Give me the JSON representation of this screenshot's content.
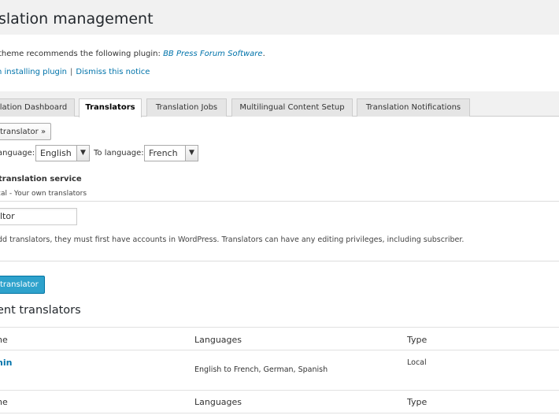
{
  "header": {
    "title": "slation management"
  },
  "notice": {
    "text": "theme recommends the following plugin:",
    "plugin_name": "BB Press Forum Software",
    "after_plugin": ".",
    "action_install": "n installing plugin",
    "separator": "|",
    "action_dismiss": "Dismiss this notice"
  },
  "tabs": [
    {
      "label": "lation Dashboard",
      "active": false
    },
    {
      "label": "Translators",
      "active": true
    },
    {
      "label": "Translation Jobs",
      "active": false
    },
    {
      "label": "Multilingual Content Setup",
      "active": false
    },
    {
      "label": "Translation Notifications",
      "active": false
    }
  ],
  "form": {
    "add_translator_button": "translator »",
    "from_language_label": "anguage:",
    "from_language_value": "English",
    "to_language_label": "To language:",
    "to_language_value": "French",
    "service_title": "translation service",
    "service_desc": "cal - Your own translators",
    "user_input_value": "ltor",
    "help_text": "dd translators, they must first have accounts in WordPress. Translators can have any editing privileges, including subscriber.",
    "submit_button": "translator"
  },
  "translators": {
    "title": "ent translators",
    "columns": [
      "ne",
      "Languages",
      "Type"
    ],
    "rows": [
      {
        "name": "nin",
        "languages": "English to French, German, Spanish",
        "type": "Local"
      }
    ],
    "footer_columns": [
      "ne",
      "Languages",
      "Type"
    ]
  },
  "colors": {
    "link": "#0073aa",
    "primary_button": "#2ea2cc"
  },
  "icons": {
    "select_arrow": "chevron-down-icon"
  }
}
